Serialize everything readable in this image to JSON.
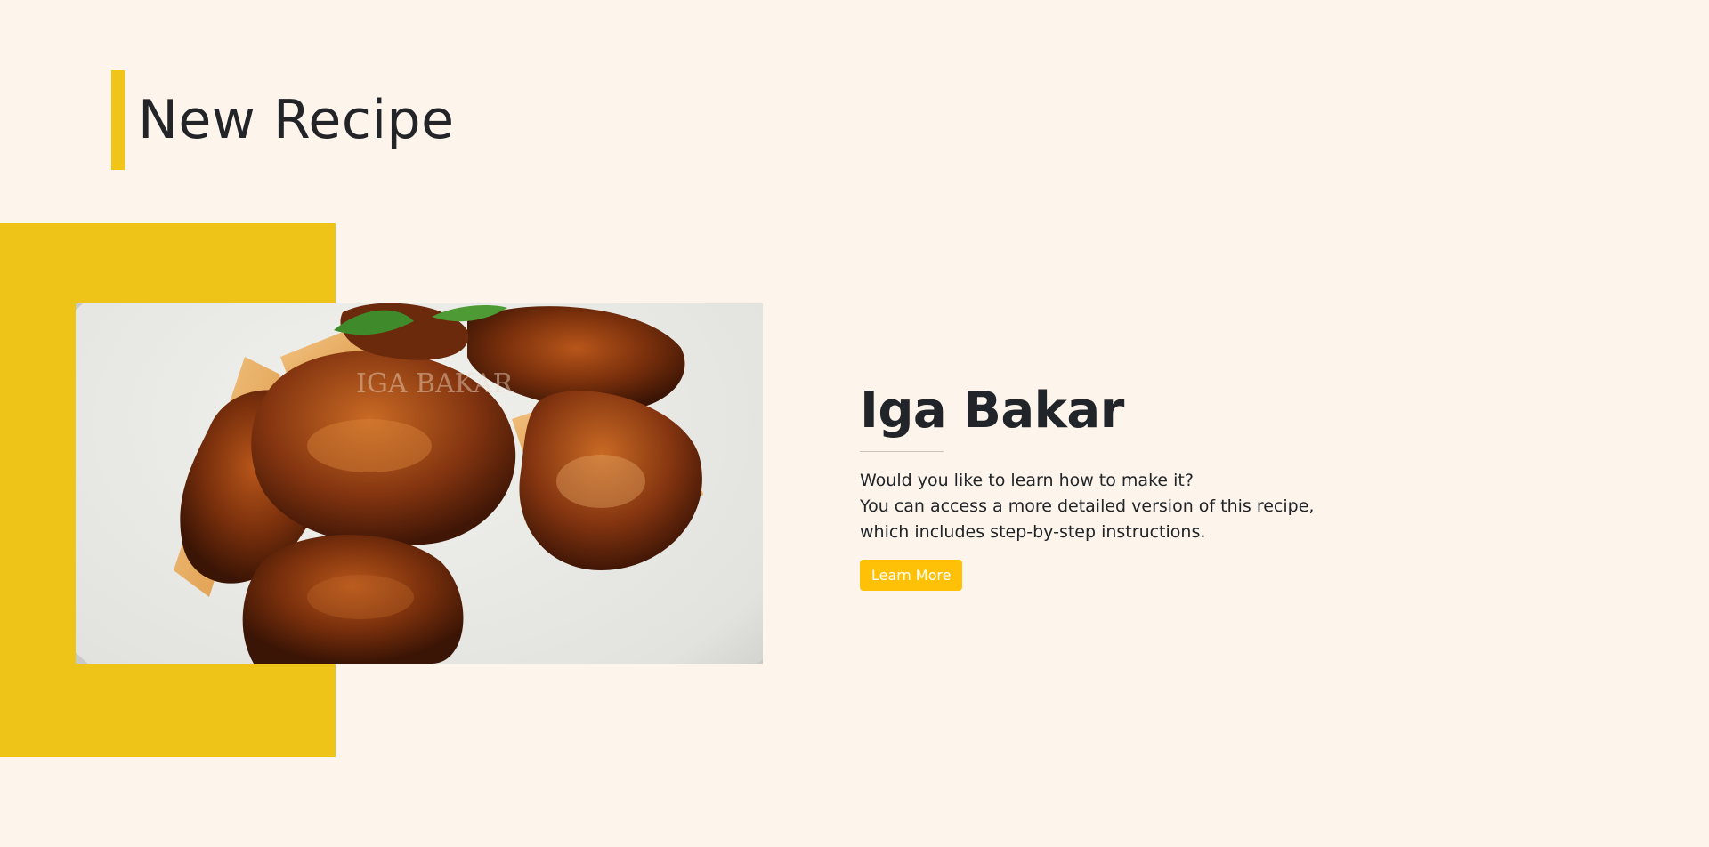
{
  "section": {
    "heading": "New Recipe"
  },
  "recipe": {
    "title": "Iga Bakar",
    "description_lines": [
      "Would you like to learn how to make it?",
      "You can access a more detailed version of this recipe,",
      "which includes step-by-step instructions."
    ],
    "button_label": "Learn More",
    "image_label": "IGA BAKAR",
    "image_subject": "grilled-ribs-photo"
  },
  "colors": {
    "background": "#fdf4ec",
    "accent_yellow": "#efc419",
    "button_yellow": "#ffc107",
    "text_dark": "#212529"
  }
}
